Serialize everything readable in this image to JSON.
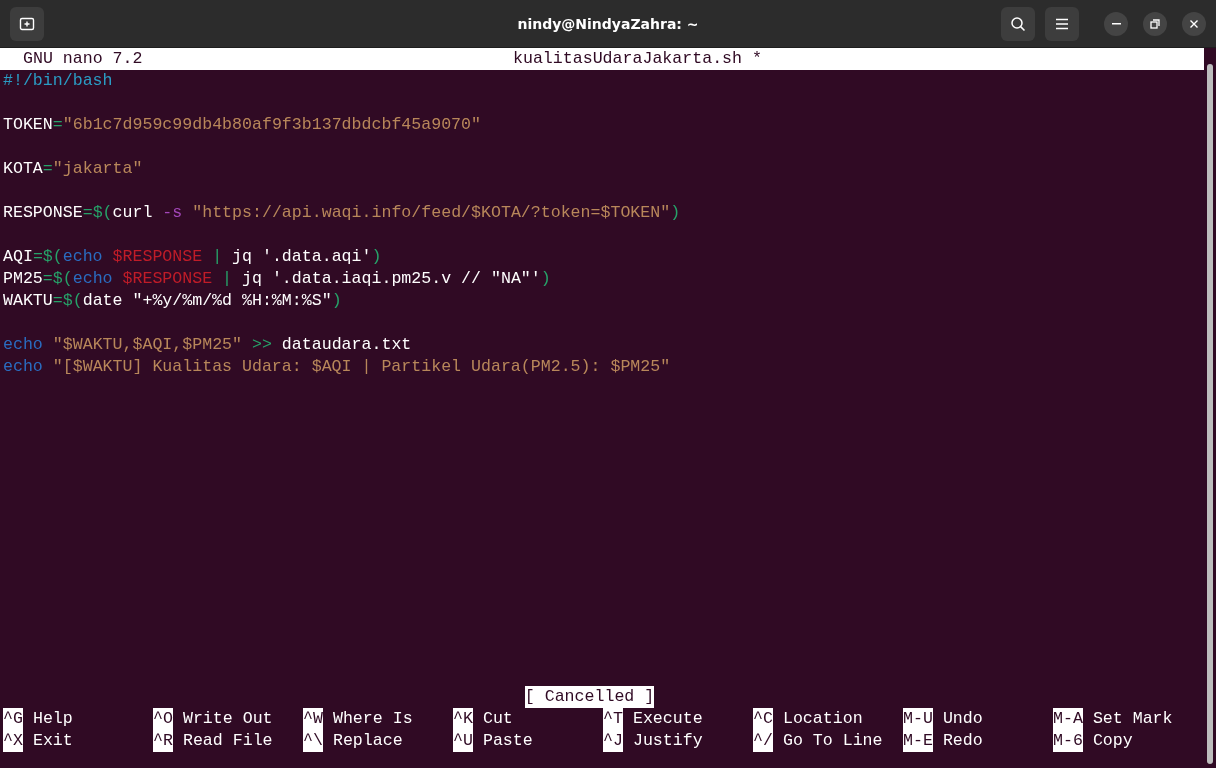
{
  "window": {
    "title": "nindy@NindyaZahra: ~"
  },
  "nano_header": {
    "version": "GNU nano 7.2",
    "filename": "kualitasUdaraJakarta.sh *"
  },
  "lines": [
    {
      "kind": "code",
      "tokens": [
        {
          "text": "#!/bin/bash",
          "kind": "comment"
        }
      ]
    },
    {
      "kind": "blank"
    },
    {
      "kind": "code",
      "tokens": [
        {
          "text": "TOKEN",
          "kind": "plain"
        },
        {
          "text": "=",
          "kind": "op"
        },
        {
          "text": "\"6b1c7d959c99db4b80af9f3b137dbdcbf45a9070\"",
          "kind": "string"
        }
      ]
    },
    {
      "kind": "blank"
    },
    {
      "kind": "code",
      "tokens": [
        {
          "text": "KOTA",
          "kind": "plain"
        },
        {
          "text": "=",
          "kind": "op"
        },
        {
          "text": "\"jakarta\"",
          "kind": "string"
        }
      ]
    },
    {
      "kind": "blank"
    },
    {
      "kind": "code",
      "tokens": [
        {
          "text": "RESPONSE",
          "kind": "plain"
        },
        {
          "text": "=$(",
          "kind": "op"
        },
        {
          "text": "curl ",
          "kind": "plain"
        },
        {
          "text": "-s",
          "kind": "flag"
        },
        {
          "text": " \"https://api.waqi.info/feed/$KOTA/?token=$TOKEN\"",
          "kind": "string"
        },
        {
          "text": ")",
          "kind": "op"
        }
      ]
    },
    {
      "kind": "blank"
    },
    {
      "kind": "code",
      "tokens": [
        {
          "text": "AQI",
          "kind": "plain"
        },
        {
          "text": "=$(",
          "kind": "op"
        },
        {
          "text": "echo",
          "kind": "keyword"
        },
        {
          "text": " $RESPONSE",
          "kind": "variable"
        },
        {
          "text": " |",
          "kind": "op"
        },
        {
          "text": " jq '.data.aqi'",
          "kind": "plain"
        },
        {
          "text": ")",
          "kind": "op"
        }
      ]
    },
    {
      "kind": "code",
      "tokens": [
        {
          "text": "PM25",
          "kind": "plain"
        },
        {
          "text": "=$(",
          "kind": "op"
        },
        {
          "text": "echo",
          "kind": "keyword"
        },
        {
          "text": " $RESPONSE",
          "kind": "variable"
        },
        {
          "text": " |",
          "kind": "op"
        },
        {
          "text": " jq '.data.iaqi.pm25.v // \"NA\"'",
          "kind": "plain"
        },
        {
          "text": ")",
          "kind": "op"
        }
      ]
    },
    {
      "kind": "code",
      "tokens": [
        {
          "text": "WAKTU",
          "kind": "plain"
        },
        {
          "text": "=$(",
          "kind": "op"
        },
        {
          "text": "date \"+%y/%m/%d %H:%M:%S\"",
          "kind": "plain"
        },
        {
          "text": ")",
          "kind": "op"
        }
      ]
    },
    {
      "kind": "blank"
    },
    {
      "kind": "code",
      "tokens": [
        {
          "text": "echo",
          "kind": "keyword"
        },
        {
          "text": " \"$WAKTU,$AQI,$PM25\"",
          "kind": "string"
        },
        {
          "text": " >>",
          "kind": "op"
        },
        {
          "text": " dataudara.txt",
          "kind": "plain"
        }
      ]
    },
    {
      "kind": "code",
      "tokens": [
        {
          "text": "echo",
          "kind": "keyword"
        },
        {
          "text": " \"[$WAKTU] Kualitas Udara: $AQI | Partikel Udara(PM2.5): $PM25\"",
          "kind": "string"
        }
      ]
    }
  ],
  "status_message": "[ Cancelled ]",
  "shortcuts": [
    [
      {
        "key": "^G",
        "label": "Help"
      },
      {
        "key": "^O",
        "label": "Write Out"
      },
      {
        "key": "^W",
        "label": "Where Is"
      },
      {
        "key": "^K",
        "label": "Cut"
      },
      {
        "key": "^T",
        "label": "Execute"
      },
      {
        "key": "^C",
        "label": "Location"
      },
      {
        "key": "M-U",
        "label": "Undo"
      },
      {
        "key": "M-A",
        "label": "Set Mark"
      }
    ],
    [
      {
        "key": "^X",
        "label": "Exit"
      },
      {
        "key": "^R",
        "label": "Read File"
      },
      {
        "key": "^\\",
        "label": "Replace"
      },
      {
        "key": "^U",
        "label": "Paste"
      },
      {
        "key": "^J",
        "label": "Justify"
      },
      {
        "key": "^/",
        "label": "Go To Line"
      },
      {
        "key": "M-E",
        "label": "Redo"
      },
      {
        "key": "M-6",
        "label": "Copy"
      }
    ]
  ]
}
